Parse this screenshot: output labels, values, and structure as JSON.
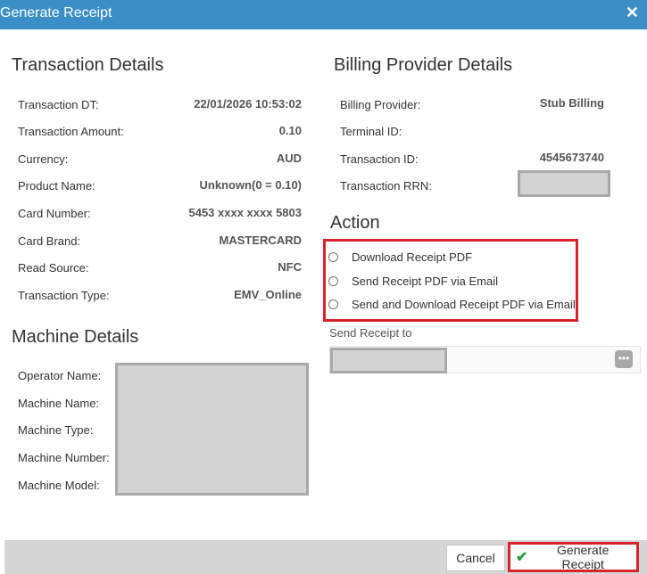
{
  "dialog": {
    "title": "Generate Receipt",
    "close_glyph": "✕"
  },
  "transaction": {
    "heading": "Transaction Details",
    "fields": [
      {
        "label": "Transaction DT:",
        "value": "22/01/2026 10:53:02"
      },
      {
        "label": "Transaction Amount:",
        "value": "0.10"
      },
      {
        "label": "Currency:",
        "value": "AUD"
      },
      {
        "label": "Product Name:",
        "value": "Unknown(0 = 0.10)"
      },
      {
        "label": "Card Number:",
        "value": "5453 xxxx xxxx 5803"
      },
      {
        "label": "Card Brand:",
        "value": "MASTERCARD"
      },
      {
        "label": "Read Source:",
        "value": "NFC"
      },
      {
        "label": "Transaction Type:",
        "value": "EMV_Online"
      }
    ]
  },
  "machine": {
    "heading": "Machine Details",
    "fields": [
      {
        "label": "Operator Name:"
      },
      {
        "label": "Machine Name:"
      },
      {
        "label": "Machine Type:"
      },
      {
        "label": "Machine Number:"
      },
      {
        "label": "Machine Model:"
      }
    ]
  },
  "billing": {
    "heading": "Billing Provider Details",
    "fields": [
      {
        "label": "Billing Provider:",
        "value": "Stub Billing"
      },
      {
        "label": "Terminal ID:",
        "value": ""
      },
      {
        "label": "Transaction ID:",
        "value": "4545673740"
      },
      {
        "label": "Transaction RRN:",
        "value": ""
      }
    ]
  },
  "action": {
    "heading": "Action",
    "options": [
      {
        "label": "Download Receipt PDF",
        "selected": false
      },
      {
        "label": "Send Receipt PDF via Email",
        "selected": false
      },
      {
        "label": "Send and Download Receipt PDF via Email",
        "selected": false
      }
    ],
    "send_to_label": "Send Receipt to",
    "dots_glyph": "•••"
  },
  "footer": {
    "cancel_label": "Cancel",
    "generate_label": "Generate Receipt",
    "check_glyph": "✔"
  },
  "colors": {
    "title_bar": "#3c8ec6",
    "highlight": "#d9232c",
    "check": "#2e9e3f"
  }
}
